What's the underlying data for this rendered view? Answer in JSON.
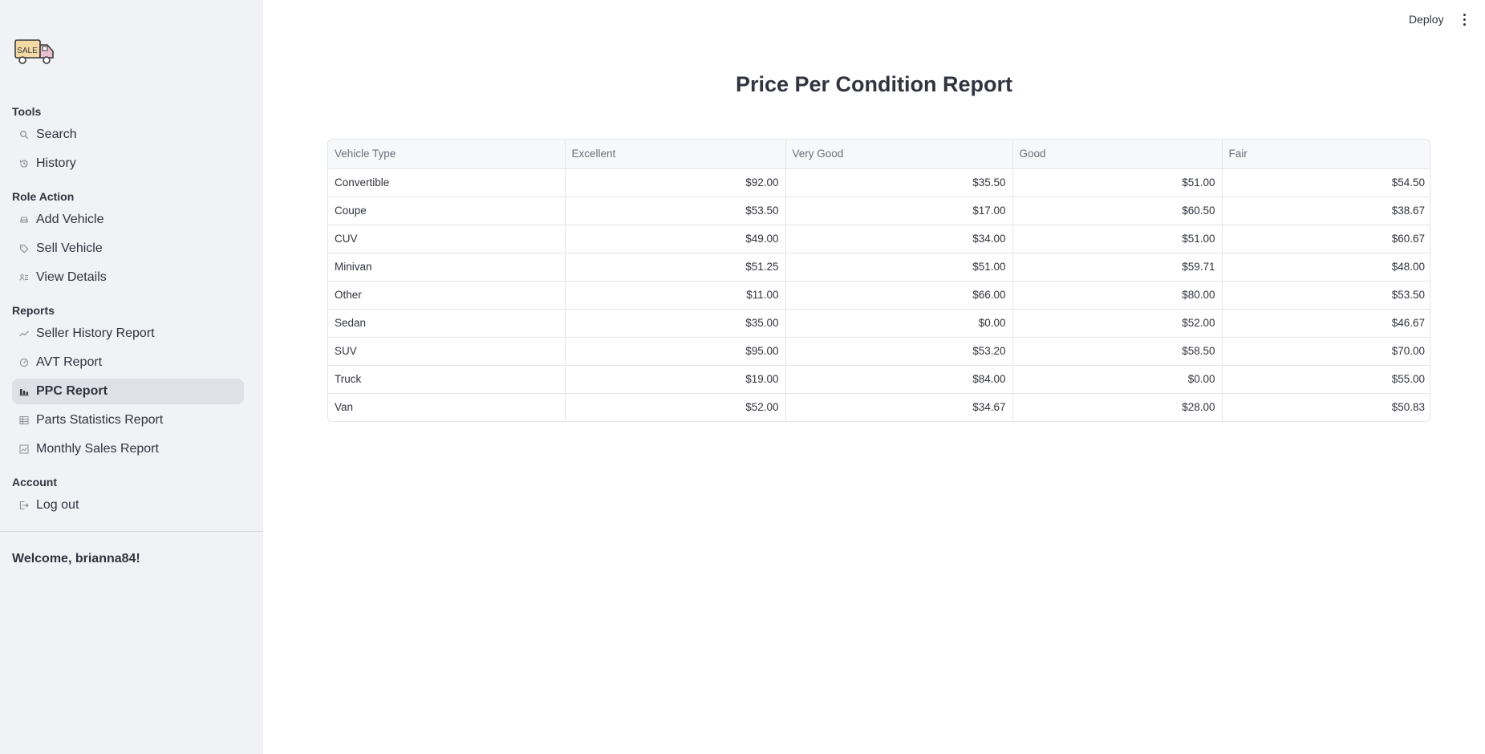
{
  "header": {
    "deploy_label": "Deploy"
  },
  "sidebar": {
    "logo_text": "SALE",
    "sections": [
      {
        "title": "Tools",
        "items": [
          {
            "label": "Search",
            "icon": "search-icon",
            "active": false
          },
          {
            "label": "History",
            "icon": "history-icon",
            "active": false
          }
        ]
      },
      {
        "title": "Role Action",
        "items": [
          {
            "label": "Add Vehicle",
            "icon": "car-icon",
            "active": false
          },
          {
            "label": "Sell Vehicle",
            "icon": "tag-icon",
            "active": false
          },
          {
            "label": "View Details",
            "icon": "details-icon",
            "active": false
          }
        ]
      },
      {
        "title": "Reports",
        "items": [
          {
            "label": "Seller History Report",
            "icon": "trend-icon",
            "active": false
          },
          {
            "label": "AVT Report",
            "icon": "gauge-icon",
            "active": false
          },
          {
            "label": "PPC Report",
            "icon": "bar-chart-icon",
            "active": true
          },
          {
            "label": "Parts Statistics Report",
            "icon": "table-icon",
            "active": false
          },
          {
            "label": "Monthly Sales Report",
            "icon": "chart-box-icon",
            "active": false
          }
        ]
      },
      {
        "title": "Account",
        "items": [
          {
            "label": "Log out",
            "icon": "logout-icon",
            "active": false
          }
        ]
      }
    ],
    "welcome": "Welcome, brianna84!"
  },
  "main": {
    "title": "Price Per Condition Report",
    "table": {
      "columns": [
        "Vehicle Type",
        "Excellent",
        "Very Good",
        "Good",
        "Fair"
      ],
      "rows": [
        [
          "Convertible",
          "$92.00",
          "$35.50",
          "$51.00",
          "$54.50"
        ],
        [
          "Coupe",
          "$53.50",
          "$17.00",
          "$60.50",
          "$38.67"
        ],
        [
          "CUV",
          "$49.00",
          "$34.00",
          "$51.00",
          "$60.67"
        ],
        [
          "Minivan",
          "$51.25",
          "$51.00",
          "$59.71",
          "$48.00"
        ],
        [
          "Other",
          "$11.00",
          "$66.00",
          "$80.00",
          "$53.50"
        ],
        [
          "Sedan",
          "$35.00",
          "$0.00",
          "$52.00",
          "$46.67"
        ],
        [
          "SUV",
          "$95.00",
          "$53.20",
          "$58.50",
          "$70.00"
        ],
        [
          "Truck",
          "$19.00",
          "$84.00",
          "$0.00",
          "$55.00"
        ],
        [
          "Van",
          "$52.00",
          "$34.67",
          "$28.00",
          "$50.83"
        ]
      ]
    }
  }
}
